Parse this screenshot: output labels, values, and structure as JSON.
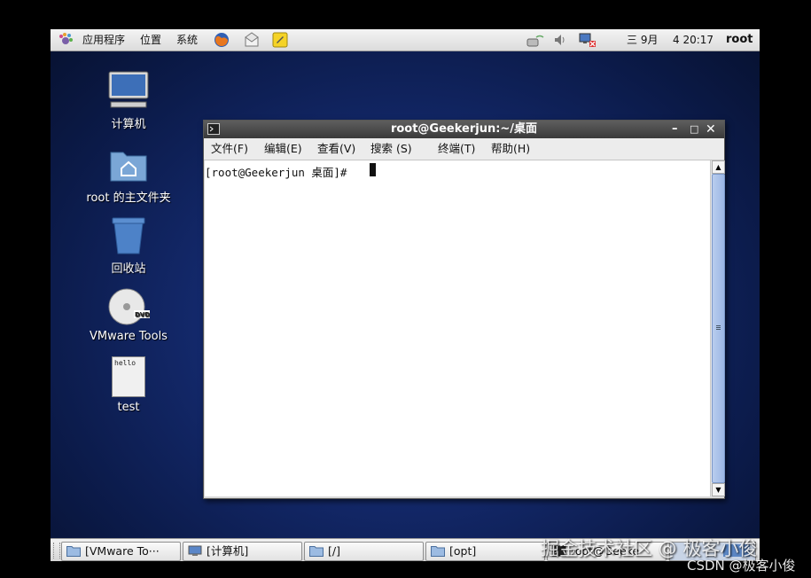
{
  "top_panel": {
    "menus": [
      "应用程序",
      "位置",
      "系统"
    ],
    "date": "三 9月",
    "time": "4 20:17",
    "user": "root",
    "icons": [
      "gnome-foot-icon",
      "firefox-icon",
      "mail-icon",
      "notes-icon",
      "network-icon",
      "volume-icon",
      "network-status-icon"
    ]
  },
  "desktop": {
    "icons": [
      {
        "label": "计算机",
        "icon": "computer-icon"
      },
      {
        "label": "root 的主文件夹",
        "icon": "home-folder-icon"
      },
      {
        "label": "回收站",
        "icon": "trash-icon"
      },
      {
        "label": "VMware Tools",
        "icon": "dvd-icon"
      },
      {
        "label": "test",
        "icon": "text-file-icon",
        "file_text": "hello"
      }
    ]
  },
  "terminal": {
    "title": "root@Geekerjun:~/桌面",
    "menu": [
      "文件(F)",
      "编辑(E)",
      "查看(V)",
      "搜索 (S)",
      "终端(T)",
      "帮助(H)"
    ],
    "prompt": "[root@Geekerjun 桌面]#",
    "controls": [
      "minimize",
      "maximize",
      "close"
    ]
  },
  "taskbar": {
    "items": [
      "[VMware To···",
      "[计算机]",
      "[/]",
      "[opt]",
      "root@Geeke"
    ]
  },
  "watermarks": {
    "main": "掘金技术社区 @ 极客小俊",
    "csdn": "CSDN @极客小俊"
  }
}
